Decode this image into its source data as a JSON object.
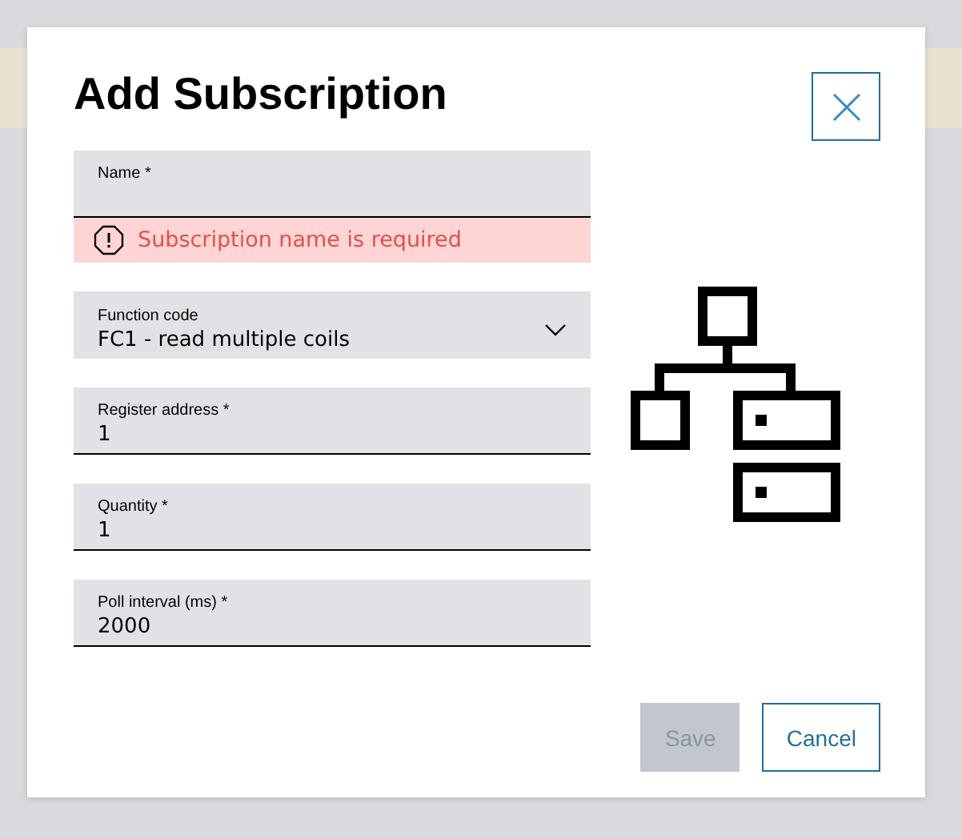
{
  "dialog": {
    "title": "Add Subscription",
    "fields": [
      {
        "kind": "text",
        "label": "Name *",
        "error": "Subscription name is required"
      },
      {
        "kind": "select",
        "label": "Function code",
        "value": "FC1 - read multiple coils"
      },
      {
        "kind": "text",
        "label": "Register address *",
        "value": "1"
      },
      {
        "kind": "text",
        "label": "Quantity *",
        "value": "1"
      },
      {
        "kind": "text",
        "label": "Poll interval (ms) *",
        "value": "2000"
      }
    ],
    "buttons": [
      {
        "kind": "primary",
        "label": "Save",
        "disabled": true
      },
      {
        "kind": "secondary",
        "label": "Cancel",
        "disabled": false
      }
    ]
  }
}
